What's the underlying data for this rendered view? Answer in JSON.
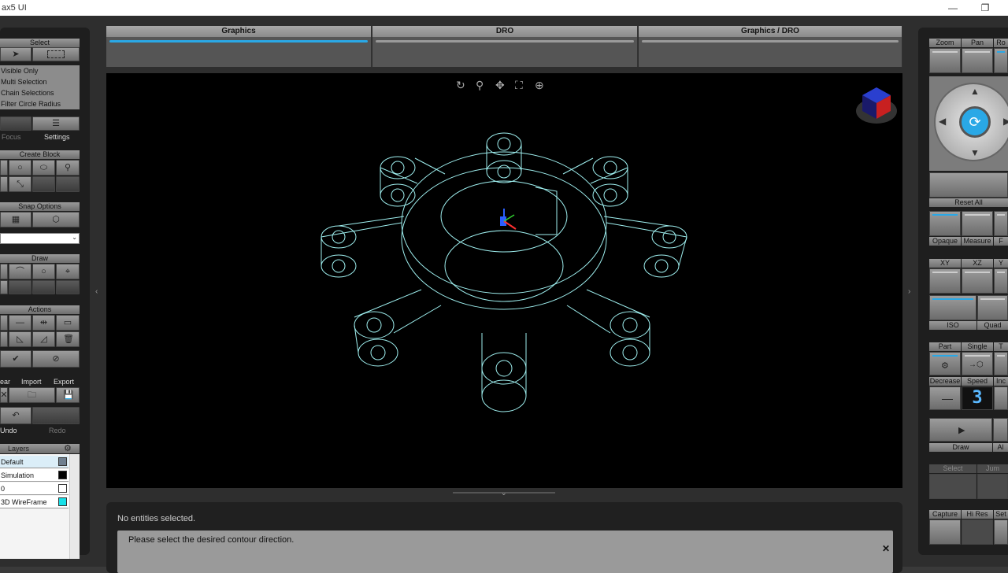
{
  "window": {
    "title": "ax5 UI",
    "minimize": "—",
    "restore": "❐"
  },
  "left": {
    "select": {
      "header": "Select",
      "options": [
        "Visible Only",
        "Multi Selection",
        "Chain Selections",
        "Filter Circle Radius"
      ],
      "focus_label": "Focus",
      "settings_label": "Settings"
    },
    "create_block": {
      "header": "Create Block"
    },
    "snap": {
      "header": "Snap Options"
    },
    "draw": {
      "header": "Draw"
    },
    "actions": {
      "header": "Actions"
    },
    "file": {
      "clear": "ear",
      "import": "Import",
      "export": "Export",
      "undo": "Undo",
      "redo": "Redo"
    },
    "layers": {
      "header": "Layers",
      "items": [
        {
          "name": "Default",
          "color": "#6f7f8f"
        },
        {
          "name": "Simulation",
          "color": "#000000"
        },
        {
          "name": "0",
          "color": "#ffffff"
        },
        {
          "name": "3D WireFrame",
          "color": "#18e0e8"
        }
      ]
    }
  },
  "tabs": [
    {
      "label": "Graphics",
      "active": true
    },
    {
      "label": "DRO",
      "active": false
    },
    {
      "label": "Graphics / DRO",
      "active": false
    }
  ],
  "viewport": {
    "tool_icons": [
      "rotate-icon",
      "zoom-icon",
      "pan-icon",
      "fit-icon",
      "zoom-window-icon"
    ]
  },
  "messages": {
    "status": "No entities selected.",
    "prompt": "Please select the desired contour direction.",
    "close": "✕"
  },
  "right": {
    "nav": {
      "labels": [
        "Zoom",
        "Pan",
        "Ro"
      ],
      "reset_all": "Reset All"
    },
    "display": {
      "labels": [
        "Opaque",
        "Measure",
        "F"
      ]
    },
    "views": {
      "labels": [
        "XY",
        "XZ",
        "Y"
      ],
      "iso": "ISO",
      "quad": "Quad"
    },
    "sim": {
      "labels": [
        "Part",
        "Single",
        "T"
      ],
      "decrease": "Decrease",
      "speed": "Speed",
      "increase": "Inc",
      "speed_value": "3",
      "draw": "Draw",
      "all": "Al"
    },
    "select_jump": {
      "select": "Select",
      "jump": "Jum"
    },
    "capture": {
      "labels": [
        "Capture",
        "Hi Res",
        "Set"
      ]
    }
  },
  "colors": {
    "accent": "#2aa8e6",
    "wireframe": "#9ff0f0",
    "background": "#2e2e2e"
  }
}
